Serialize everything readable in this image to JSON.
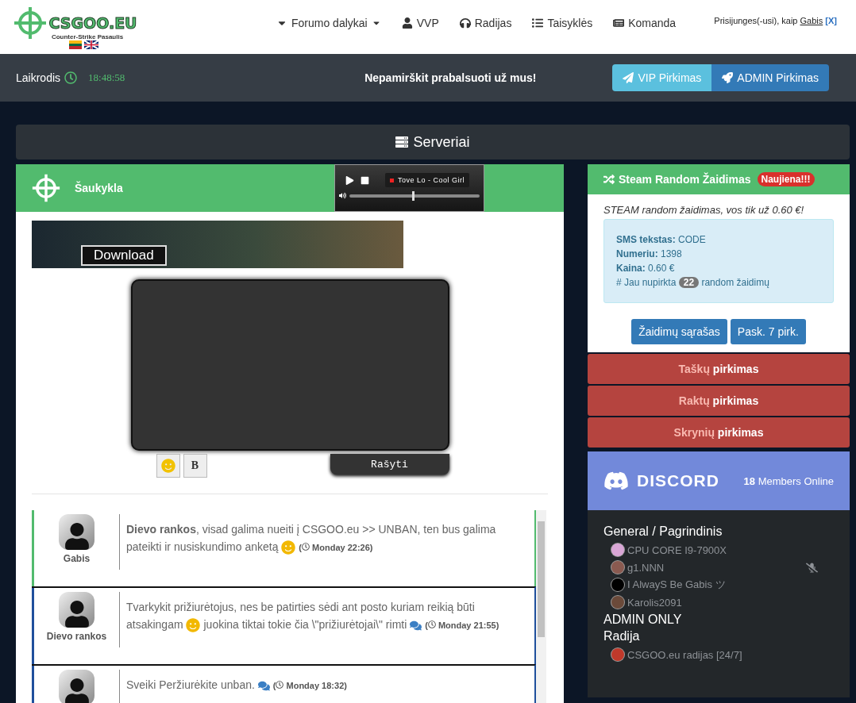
{
  "logo": {
    "title": "CSGOO.EU",
    "subtitle": "Counter-Strike Pasaulis"
  },
  "nav": [
    {
      "kind": "dropdown",
      "label": "Forumo dalykai"
    },
    {
      "kind": "user",
      "label": "VVP"
    },
    {
      "kind": "radio",
      "label": "Radijas"
    },
    {
      "kind": "rules",
      "label": "Taisyklės"
    },
    {
      "kind": "team",
      "label": "Komanda"
    }
  ],
  "login": {
    "text": "Prisijunges(-usi), kaip",
    "user": "Gabis",
    "logout": "[X]"
  },
  "topbar": {
    "clock_label": "Laikrodis",
    "time": "18:48:58",
    "message": "Nepamirškit prabalsuoti už mus!",
    "buttons": [
      {
        "kind": "vip",
        "label": "VIP Pirkimas"
      },
      {
        "kind": "admin",
        "label": "ADMIN Pirkimas"
      }
    ]
  },
  "servers": {
    "label": "Serveriai"
  },
  "shoutbox": {
    "title": "Šaukykla",
    "banner": "Download",
    "player": {
      "track": "Tove Lo - Cool Girl",
      "level": 0.49
    },
    "submit": "Rašyti",
    "bold_button": "B",
    "messages": [
      {
        "author": "Gabis",
        "color": "#52bb6e",
        "parts": [
          {
            "kind": "text",
            "text": "**Dievo rankos**, visad galima nueiti į CSGOO.eu >> UNBAN, ten bus galima pateikti ir nusiskundimo anketą"
          },
          {
            "kind": "smile"
          },
          {
            "kind": "time",
            "open": "(",
            "text": "Monday 22:26)"
          }
        ]
      },
      {
        "author": "Dievo rankos",
        "color": "#1f4f9c",
        "parts": [
          {
            "kind": "text",
            "text": "Tvarkykit prižiurėtojus, nes be patirties sėdi ant posto kuriam reikią būti atsakingam"
          },
          {
            "kind": "smile"
          },
          {
            "kind": "text",
            "text": "juokina tiktai tokie čia \\\"prižiurėtojai\\\" rimti"
          },
          {
            "kind": "chat"
          },
          {
            "kind": "time",
            "open": "(",
            "text": "Monday 21:55)"
          }
        ]
      },
      {
        "color": "#1f4f9c",
        "parts": [
          {
            "kind": "text",
            "text": "Sveiki Peržiurėkite unban."
          },
          {
            "kind": "chat"
          },
          {
            "kind": "time",
            "open": "(",
            "text": "Monday 18:32)"
          }
        ]
      }
    ]
  },
  "steam": {
    "title": "Steam Random Žaidimas",
    "badge": "Naujiena!!!",
    "intro": "STEAM random žaidimas, vos tik už 0.60 €!",
    "info": [
      {
        "kind": "field",
        "label": "SMS tekstas:",
        "value": "CODE"
      },
      {
        "kind": "field",
        "label": "Numeriu:",
        "value": "1398"
      },
      {
        "kind": "field",
        "label": "Kaina:",
        "value": "0.60 €"
      },
      {
        "kind": "count",
        "label": "# Jau nupirkta",
        "value": "22",
        "suffix": "random žaidimų"
      }
    ],
    "buttons": [
      "Žaidimų sąrašas",
      "Pask. 7 pirk."
    ]
  },
  "shop_buttons": [
    {
      "highlight": "Taškų",
      "label": "pirkimas"
    },
    {
      "highlight": "Raktų",
      "label": "pirkimas"
    },
    {
      "highlight": "Skrynių",
      "label": "pirkimas"
    }
  ],
  "discord": {
    "wordmark": "DISCORD",
    "count": "18",
    "count_label": "Members Online",
    "channels": [
      {
        "name": "General / Pagrindinis",
        "members": [
          {
            "name": "CPU CORE I9-7900X",
            "muted": false,
            "color": "#d9a6d6"
          },
          {
            "name": "g1.NNN",
            "muted": true,
            "color": "#8a5a50"
          },
          {
            "name": "I AlwayS Be Gabis ツ",
            "muted": false,
            "color": "#000000"
          },
          {
            "name": "Karolis2091",
            "muted": false,
            "color": "#6b4a3a"
          }
        ]
      },
      {
        "name": "ADMIN ONLY"
      },
      {
        "name": "Radija",
        "members": [
          {
            "name": "CSGOO.eu radijas [24/7]",
            "muted": false,
            "color": "#c0392b"
          }
        ]
      }
    ]
  }
}
